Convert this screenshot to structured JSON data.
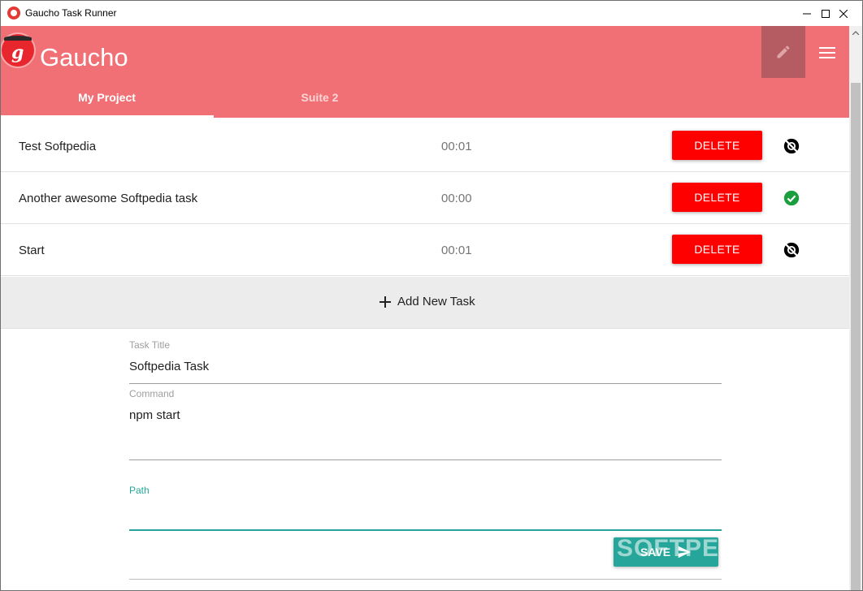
{
  "window": {
    "title": "Gaucho Task Runner"
  },
  "header": {
    "brand": "Gaucho"
  },
  "tabs": [
    {
      "label": "My Project",
      "active": true
    },
    {
      "label": "Suite 2",
      "active": false
    }
  ],
  "tasks": [
    {
      "name": "Test Softpedia",
      "time": "00:01",
      "delete_label": "DELETE",
      "status_icon": "error-off-icon"
    },
    {
      "name": "Another awesome Softpedia task",
      "time": "00:00",
      "delete_label": "DELETE",
      "status_icon": "success-check-icon"
    },
    {
      "name": "Start",
      "time": "00:01",
      "delete_label": "DELETE",
      "status_icon": "error-off-icon"
    }
  ],
  "add_task": {
    "label": "Add New Task"
  },
  "form": {
    "task_title": {
      "label": "Task Title",
      "value": "Softpedia Task"
    },
    "command": {
      "label": "Command",
      "value": "npm start"
    },
    "path": {
      "label": "Path",
      "value": ""
    },
    "save_label": "SAVE"
  },
  "watermark": "SOFTPEDIA",
  "colors": {
    "header": "#f07075",
    "delete": "#ff0000",
    "save": "#26a69a",
    "success": "#1b9e3e"
  }
}
